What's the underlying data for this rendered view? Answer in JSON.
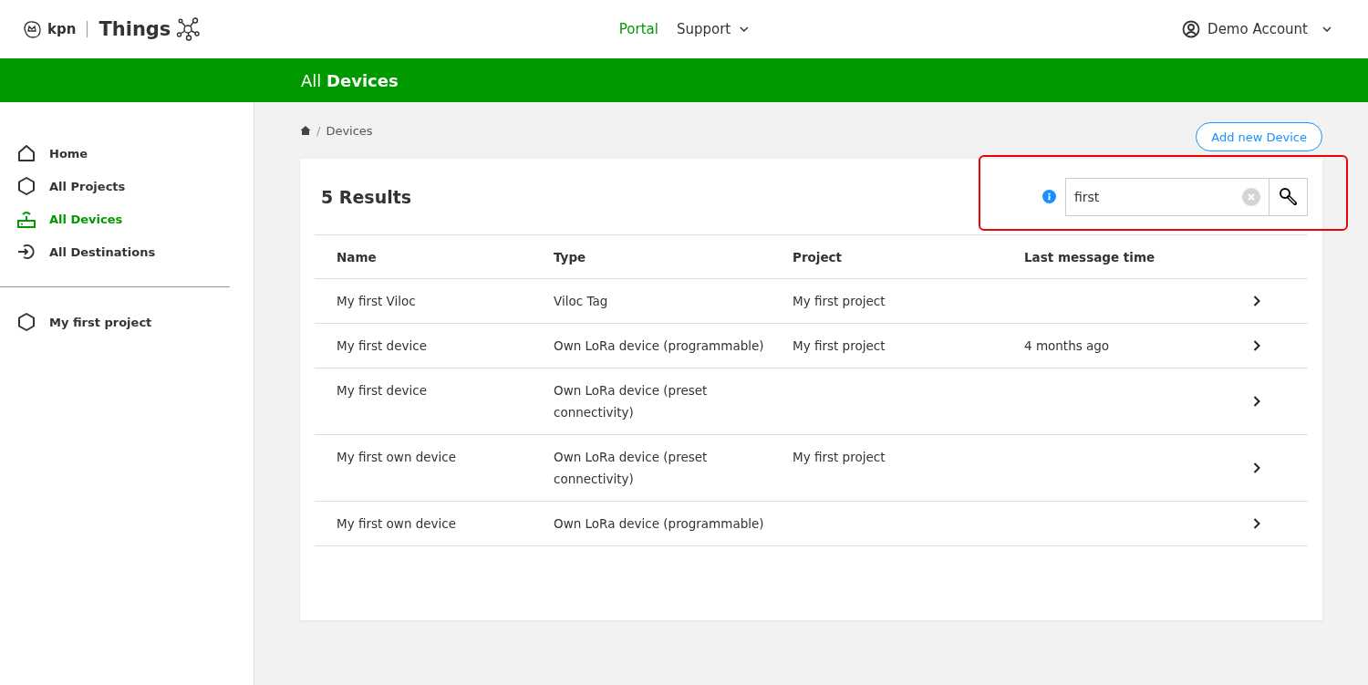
{
  "header": {
    "logo_brand": "kpn",
    "logo_product": "Things",
    "nav": [
      {
        "label": "Portal",
        "selected": true,
        "dropdown": false
      },
      {
        "label": "Support",
        "selected": false,
        "dropdown": true
      }
    ],
    "account": "Demo Account"
  },
  "title_bar": {
    "title": "All **Devices**"
  },
  "sidebar": {
    "items": [
      {
        "label": "Home",
        "kind": "home",
        "selected": false
      },
      {
        "label": "All Projects",
        "kind": "hexagon",
        "selected": false
      },
      {
        "label": "All Devices",
        "kind": "router",
        "selected": true
      },
      {
        "label": "All Destinations",
        "kind": "destination",
        "selected": false
      }
    ],
    "projects": [
      {
        "label": "My first project",
        "kind": "hexagon",
        "selected": false
      }
    ]
  },
  "breadcrumb": {
    "separator": "/",
    "items": [
      "Devices"
    ]
  },
  "add_button": "Add new Device",
  "results": {
    "count": "5 Results",
    "search": {
      "value": "first"
    },
    "highlighted": true,
    "columns": [
      "Name",
      "Type",
      "Project",
      "Last message time"
    ],
    "rows": [
      [
        "My first Viloc",
        "Viloc Tag",
        "My first project",
        ""
      ],
      [
        "My first device",
        "Own LoRa device (programmable)",
        "My first project",
        "4 months ago"
      ],
      [
        "My first device",
        "Own LoRa device (preset connectivity)",
        "",
        ""
      ],
      [
        "My first own device",
        "Own LoRa device (preset connectivity)",
        "My first project",
        ""
      ],
      [
        "My first own device",
        "Own LoRa device (programmable)",
        "",
        ""
      ]
    ]
  }
}
